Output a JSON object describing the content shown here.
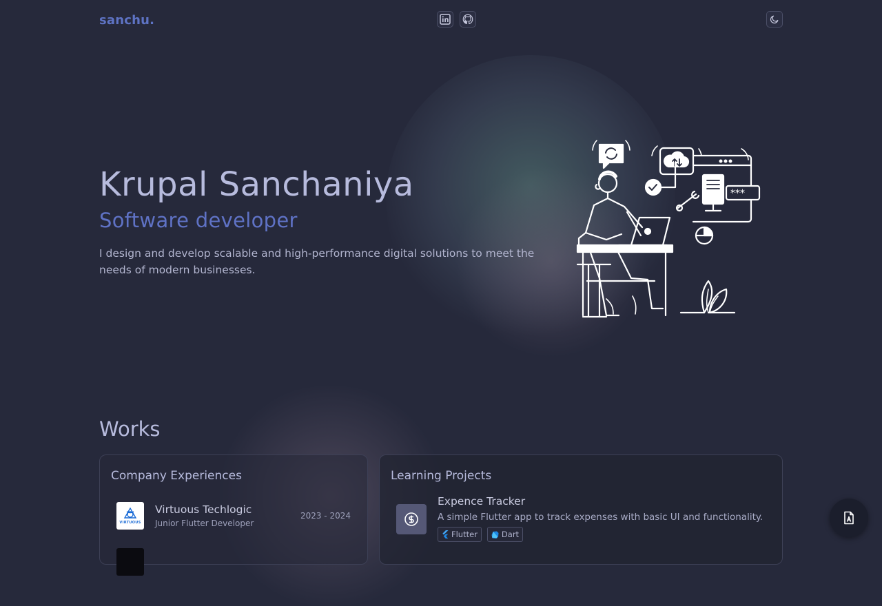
{
  "header": {
    "logo": "sanchu.",
    "social": [
      {
        "icon": "linkedin-icon"
      },
      {
        "icon": "github-icon"
      }
    ],
    "theme_toggle_icon": "moon-icon"
  },
  "hero": {
    "name": "Krupal Sanchaniya",
    "role": "Software developer",
    "description": "I design and develop scalable and high-performance digital solutions to meet the needs of modern businesses.",
    "illustration_icon": "developer-at-desk-illustration"
  },
  "works": {
    "title": "Works",
    "company": {
      "title": "Company Experiences",
      "items": [
        {
          "logo_text": "VIRTUOUS",
          "name": "Virtuous Techlogic",
          "role": "Junior Flutter Developer",
          "dates": "2023 - 2024"
        }
      ]
    },
    "learning": {
      "title": "Learning Projects",
      "items": [
        {
          "icon": "dollar-icon",
          "name": "Expence Tracker",
          "description": "A simple Flutter app to track expenses with basic UI and functionality.",
          "tags": [
            "Flutter",
            "Dart"
          ]
        }
      ]
    }
  },
  "fab": {
    "icon": "resume-document-icon"
  },
  "colors": {
    "background": "#26293b",
    "accent": "#5e73c4",
    "text": "#b7bbdd"
  }
}
